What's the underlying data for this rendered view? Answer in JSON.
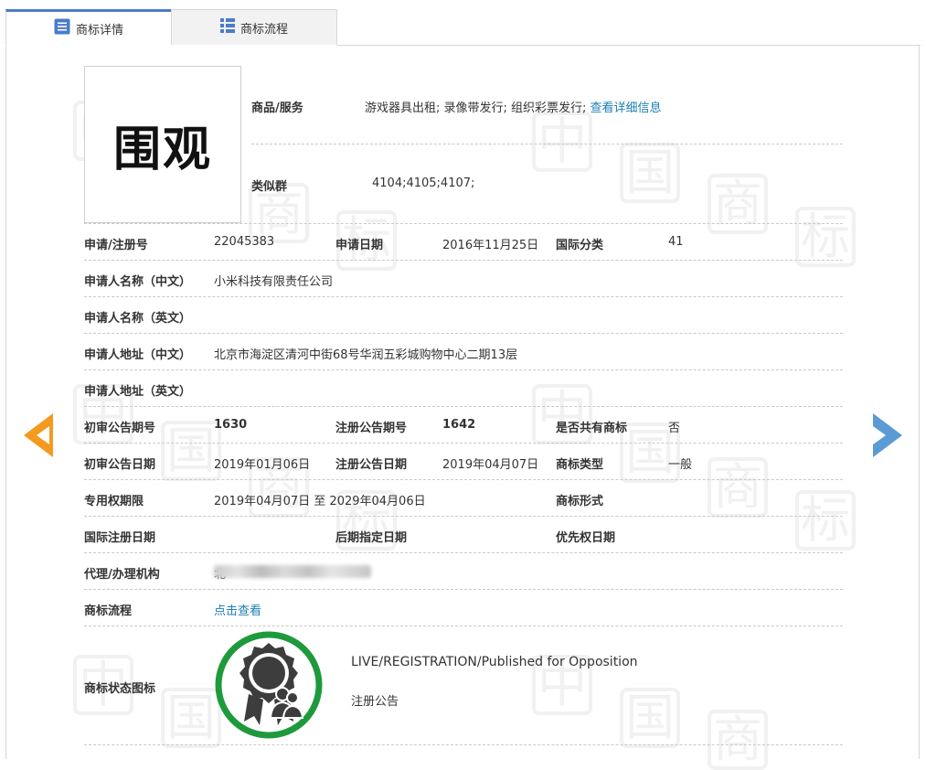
{
  "tabs": [
    {
      "label": "商标详情",
      "icon": "list-icon",
      "active": true
    },
    {
      "label": "商标流程",
      "icon": "grid-icon",
      "active": false
    }
  ],
  "mark": {
    "text": "围观"
  },
  "goods_services": {
    "label": "商品/服务",
    "value": "游戏器具出租; 录像带发行; 组织彩票发行;",
    "link": "查看详细信息"
  },
  "similar_groups": {
    "label": "类似群",
    "value": "4104;4105;4107;"
  },
  "fields": {
    "reg_no": {
      "label": "申请/注册号",
      "value": "22045383"
    },
    "app_date": {
      "label": "申请日期",
      "value": "2016年11月25日"
    },
    "intl_class": {
      "label": "国际分类",
      "value": "41"
    },
    "applicant_cn": {
      "label": "申请人名称（中文）",
      "value": "小米科技有限责任公司"
    },
    "applicant_en": {
      "label": "申请人名称（英文）",
      "value": ""
    },
    "address_cn": {
      "label": "申请人地址（中文）",
      "value": "北京市海淀区清河中街68号华润五彩城购物中心二期13层"
    },
    "address_en": {
      "label": "申请人地址（英文）",
      "value": ""
    },
    "prelim_issue": {
      "label": "初审公告期号",
      "value": "1630"
    },
    "reg_issue": {
      "label": "注册公告期号",
      "value": "1642"
    },
    "shared": {
      "label": "是否共有商标",
      "value": "否"
    },
    "prelim_date": {
      "label": "初审公告日期",
      "value": "2019年01月06日"
    },
    "reg_date": {
      "label": "注册公告日期",
      "value": "2019年04月07日"
    },
    "mark_type": {
      "label": "商标类型",
      "value": "一般"
    },
    "exclusive_period": {
      "label": "专用权期限",
      "value": "2019年04月07日 至 2029年04月06日"
    },
    "mark_form": {
      "label": "商标形式",
      "value": ""
    },
    "intl_reg_date": {
      "label": "国际注册日期",
      "value": ""
    },
    "later_date": {
      "label": "后期指定日期",
      "value": ""
    },
    "priority_date": {
      "label": "优先权日期",
      "value": ""
    },
    "agent": {
      "label": "代理/办理机构",
      "value": "北"
    },
    "process": {
      "label": "商标流程",
      "link": "点击查看"
    },
    "status": {
      "label": "商标状态图标",
      "status_en": "LIVE/REGISTRATION/Published for Opposition",
      "status_cn": "注册公告"
    }
  },
  "colors": {
    "accent": "#4a7cc9",
    "link": "#1a7fb5",
    "prev_arrow": "#f39a1f",
    "next_arrow": "#5b9bd5",
    "status_ring": "#1e9a3c"
  }
}
